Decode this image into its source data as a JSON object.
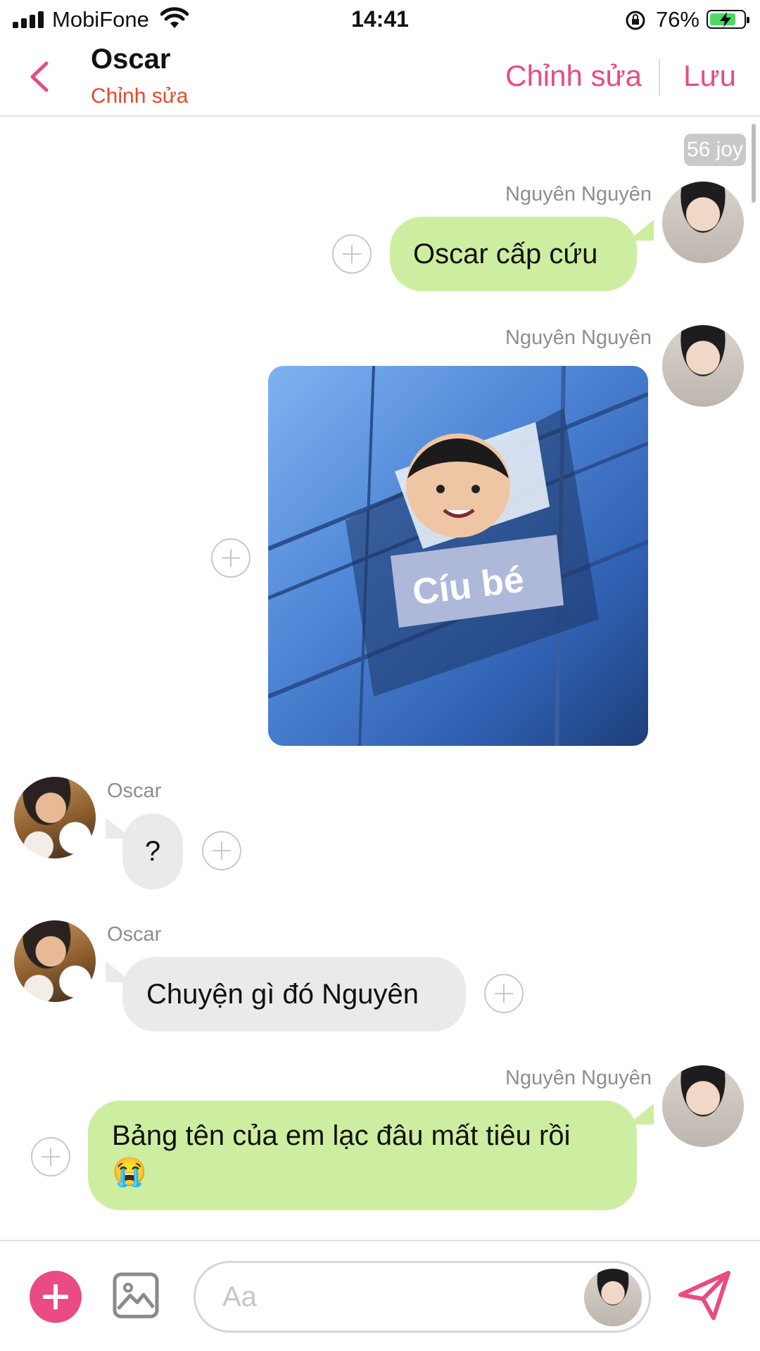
{
  "status_bar": {
    "carrier": "MobiFone",
    "time": "14:41",
    "battery": "76%"
  },
  "header": {
    "title": "Oscar",
    "subtitle": "Chỉnh sửa",
    "edit_label": "Chỉnh sửa",
    "save_label": "Lưu"
  },
  "chat": {
    "top_pill": "56 joy",
    "messages": [
      {
        "sender": "Nguyên Nguyên",
        "text": "Oscar cấp cứu"
      },
      {
        "sender": "Nguyên Nguyên",
        "sticker_text": "Cíu bé"
      },
      {
        "sender": "Oscar",
        "text": "?"
      },
      {
        "sender": "Oscar",
        "text": "Chuyện gì đó Nguyên"
      },
      {
        "sender": "Nguyên Nguyên",
        "text": "Bảng tên của em lạc đâu mất tiêu rồi",
        "emoji": "😭"
      }
    ]
  },
  "composer": {
    "placeholder": "Aa"
  },
  "colors": {
    "accent": "#e94b82",
    "outgoing_bubble": "#cdeea0",
    "incoming_bubble": "#eaeaec",
    "subtitle": "#e8482a"
  }
}
